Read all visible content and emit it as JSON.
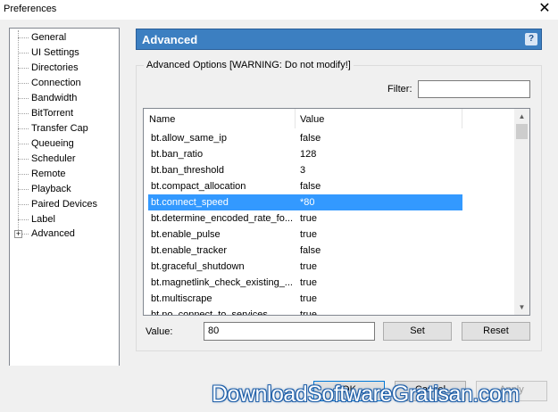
{
  "window": {
    "title": "Preferences",
    "close_glyph": "✕"
  },
  "sidebar": {
    "items": [
      {
        "label": "General"
      },
      {
        "label": "UI Settings"
      },
      {
        "label": "Directories"
      },
      {
        "label": "Connection"
      },
      {
        "label": "Bandwidth"
      },
      {
        "label": "BitTorrent"
      },
      {
        "label": "Transfer Cap"
      },
      {
        "label": "Queueing"
      },
      {
        "label": "Scheduler"
      },
      {
        "label": "Remote"
      },
      {
        "label": "Playback"
      },
      {
        "label": "Paired Devices"
      },
      {
        "label": "Label"
      },
      {
        "label": "Advanced",
        "expander": "+"
      }
    ]
  },
  "header": {
    "title": "Advanced",
    "help_glyph": "?"
  },
  "group": {
    "label": "Advanced Options [WARNING: Do not modify!]"
  },
  "filter": {
    "label": "Filter:",
    "value": ""
  },
  "table": {
    "columns": [
      "Name",
      "Value"
    ],
    "rows": [
      {
        "name": "bt.allow_same_ip",
        "value": "false"
      },
      {
        "name": "bt.ban_ratio",
        "value": "128"
      },
      {
        "name": "bt.ban_threshold",
        "value": "3"
      },
      {
        "name": "bt.compact_allocation",
        "value": "false"
      },
      {
        "name": "bt.connect_speed",
        "value": "*80",
        "selected": true
      },
      {
        "name": "bt.determine_encoded_rate_fo...",
        "value": "true"
      },
      {
        "name": "bt.enable_pulse",
        "value": "true"
      },
      {
        "name": "bt.enable_tracker",
        "value": "false"
      },
      {
        "name": "bt.graceful_shutdown",
        "value": "true"
      },
      {
        "name": "bt.magnetlink_check_existing_...",
        "value": "true"
      },
      {
        "name": "bt.multiscrape",
        "value": "true"
      },
      {
        "name": "bt.no_connect_to_services",
        "value": "true"
      }
    ],
    "scroll_up_glyph": "▲",
    "scroll_down_glyph": "▼"
  },
  "editor": {
    "label": "Value:",
    "value": "80",
    "set_label": "Set",
    "reset_label": "Reset"
  },
  "footer": {
    "ok_label": "OK",
    "cancel_label": "Cancel",
    "apply_label": "Apply"
  },
  "watermark": {
    "text": "DownloadSoftwareGratisan.com"
  },
  "colors": {
    "header_bg": "#3c7fc1",
    "selection": "#3399ff"
  }
}
